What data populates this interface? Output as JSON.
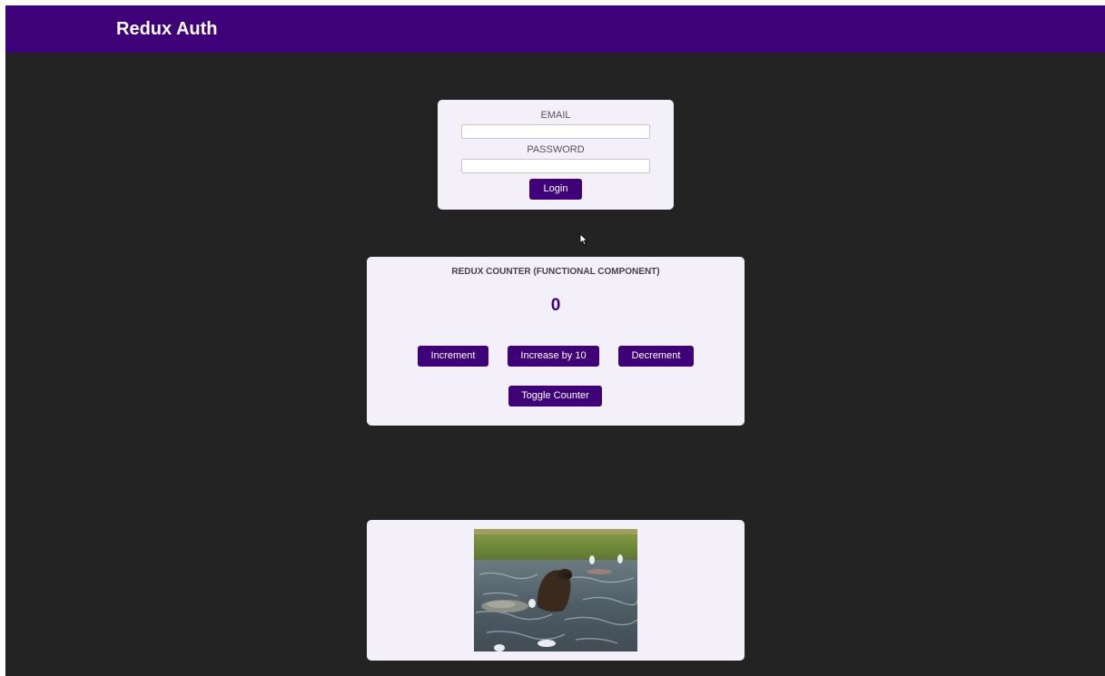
{
  "header": {
    "title": "Redux Auth",
    "background": "#3f0178"
  },
  "login": {
    "email_label": "EMAIL",
    "email_value": "",
    "password_label": "PASSWORD",
    "password_value": "",
    "login_label": "Login"
  },
  "counter": {
    "title": "REDUX COUNTER (FUNCTIONAL COMPONENT)",
    "value": "0",
    "buttons": {
      "increment": "Increment",
      "increase_by_10": "Increase by 10",
      "decrement": "Decrement",
      "toggle": "Toggle Counter"
    }
  },
  "media": {
    "content": "video-frame-bear-in-river"
  },
  "colors": {
    "accent": "#3f0178",
    "page_background": "#232323",
    "card_background": "#f3f0fa"
  },
  "icons": [
    "mouse-pointer-icon"
  ]
}
